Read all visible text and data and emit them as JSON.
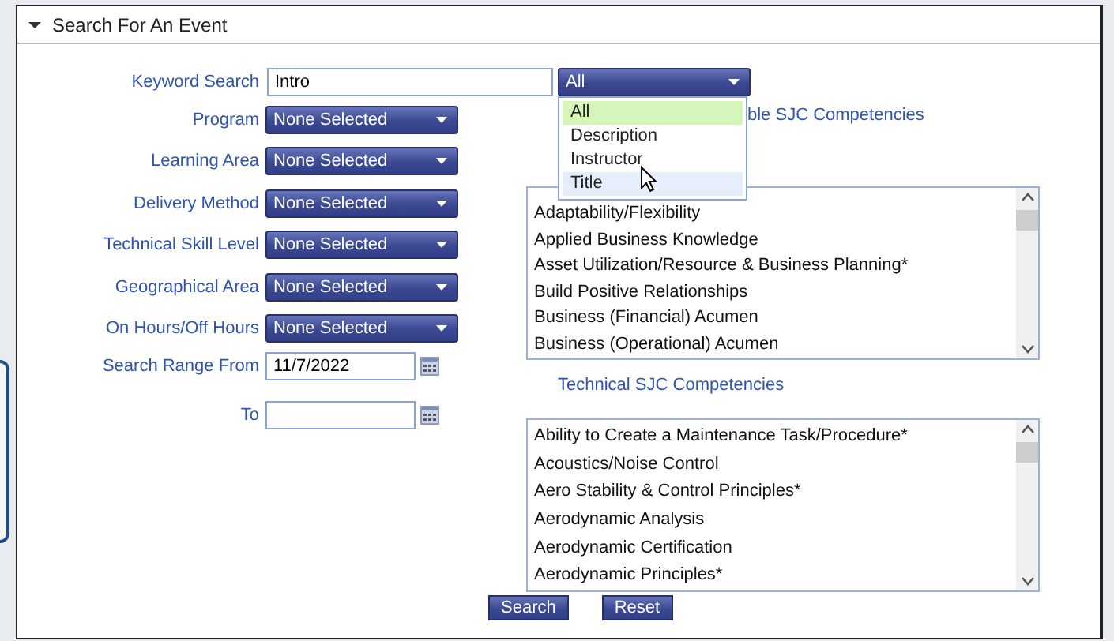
{
  "section": {
    "title": "Search For An Event",
    "expanded": true
  },
  "keyword": {
    "label": "Keyword Search",
    "value": "Intro",
    "scope": {
      "value": "All",
      "open": true,
      "options": [
        {
          "label": "All",
          "selected": true,
          "hover": false
        },
        {
          "label": "Description",
          "selected": false,
          "hover": false
        },
        {
          "label": "Instructor",
          "selected": false,
          "hover": false
        },
        {
          "label": "Title",
          "selected": false,
          "hover": true
        }
      ]
    }
  },
  "filters": [
    {
      "label": "Program",
      "value": "None Selected"
    },
    {
      "label": "Learning Area",
      "value": "None Selected"
    },
    {
      "label": "Delivery Method",
      "value": "None Selected"
    },
    {
      "label": "Technical Skill Level",
      "value": "None Selected"
    },
    {
      "label": "Geographical Area",
      "value": "None Selected"
    },
    {
      "label": "On Hours/Off Hours",
      "value": "None Selected"
    }
  ],
  "date_from": {
    "label": "Search Range From",
    "value": "11/7/2022"
  },
  "date_to": {
    "label": "To"
  },
  "lists": [
    {
      "heading": "ble SJC Competencies",
      "items": [
        "Adaptability/Flexibility",
        "Applied Business Knowledge",
        "Asset Utilization/Resource & Business Planning*",
        "Build Positive Relationships",
        "Business (Financial) Acumen",
        "Business (Operational) Acumen"
      ]
    },
    {
      "heading": "Technical SJC Competencies",
      "items": [
        "Ability to Create a Maintenance Task/Procedure*",
        "Acoustics/Noise Control",
        "Aero Stability & Control Principles*",
        "Aerodynamic Analysis",
        "Aerodynamic Certification",
        "Aerodynamic Principles*"
      ]
    }
  ],
  "buttons": [
    "Search",
    "Reset"
  ]
}
